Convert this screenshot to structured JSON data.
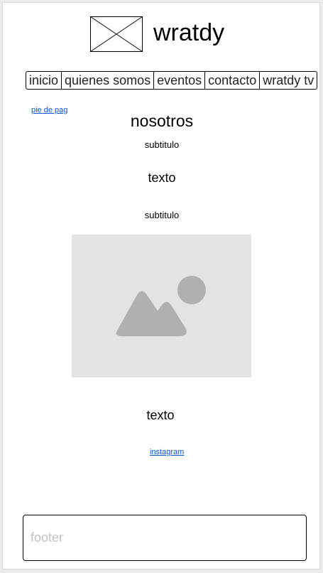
{
  "header": {
    "logo_icon": "image-placeholder-icon",
    "title": "wratdy"
  },
  "nav": {
    "items": [
      {
        "label": "inicio"
      },
      {
        "label": "quienes somos"
      },
      {
        "label": "eventos"
      },
      {
        "label": "contacto"
      },
      {
        "label": "wratdy tv"
      }
    ]
  },
  "links": {
    "pie_de_pag": "pie de pag",
    "instagram": "instagram"
  },
  "main": {
    "heading": "nosotros",
    "subtitle_1": "subtitulo",
    "text_1": "texto",
    "subtitle_2": "subtitulo",
    "image_icon": "image-placeholder-icon",
    "text_2": "texto"
  },
  "footer": {
    "placeholder": "footer"
  },
  "colors": {
    "link": "#0b57d0",
    "image_bg": "#e3e3e3",
    "image_icon": "#b0b0b0",
    "footer_text": "#c2c2c2"
  }
}
